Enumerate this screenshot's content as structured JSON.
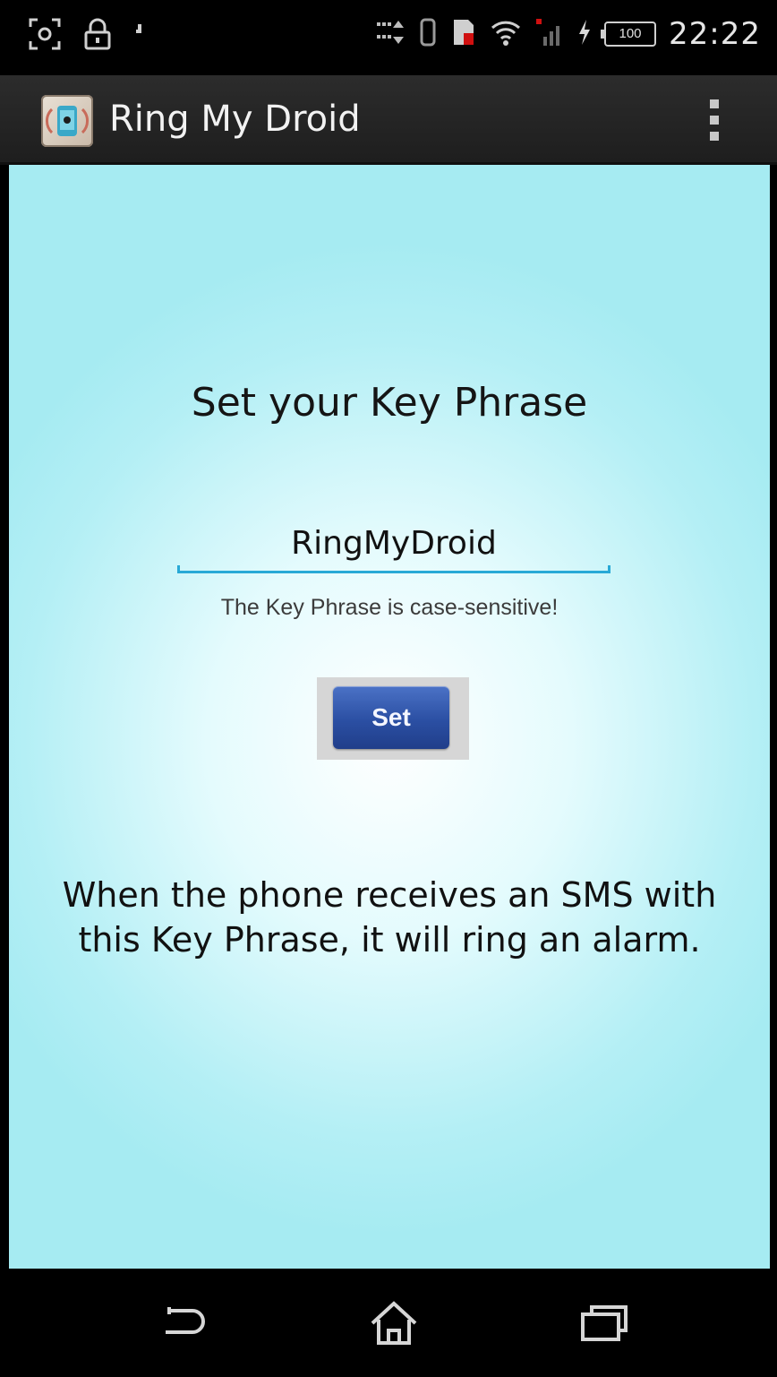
{
  "status_bar": {
    "time": "22:22",
    "battery_level": "100",
    "icons": [
      "screenshot-icon",
      "lock-icon",
      "notification-icon",
      "data-activity-icon",
      "vibrate-icon",
      "sim-icon",
      "wifi-icon",
      "signal-icon",
      "charging-icon",
      "battery-icon"
    ]
  },
  "action_bar": {
    "title": "Ring My Droid",
    "app_icon": "ring-my-droid-app-icon",
    "overflow_icon": "overflow-menu-icon"
  },
  "main": {
    "heading": "Set your Key Phrase",
    "key_phrase_value": "RingMyDroid",
    "hint": "The Key Phrase is case-sensitive!",
    "set_button_label": "Set",
    "description": "When the phone receives an SMS with this Key Phrase, it will ring an alarm."
  },
  "nav_bar": {
    "icons": [
      "back-icon",
      "home-icon",
      "recent-apps-icon"
    ]
  },
  "colors": {
    "accent": "#28a9d6",
    "button": "#2b4fa3",
    "background": "#a6ebf2"
  }
}
